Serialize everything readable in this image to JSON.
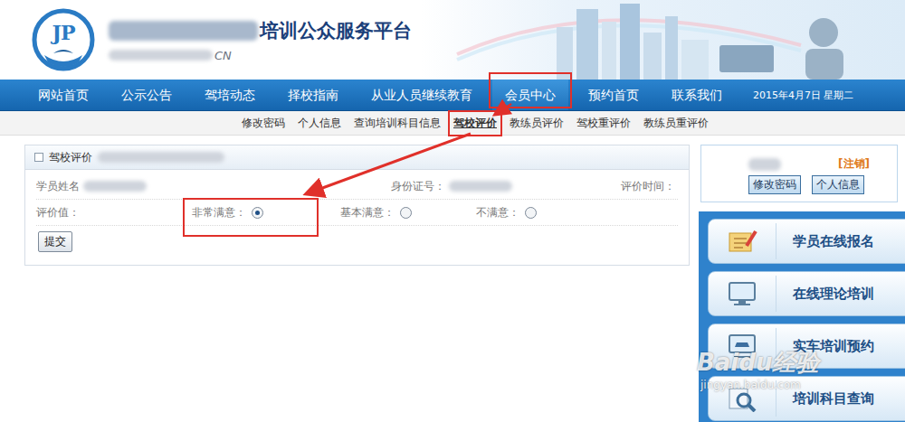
{
  "header": {
    "logo": "JP",
    "title": "培训公众服务平台",
    "subtitle": "CN"
  },
  "nav": [
    {
      "label": "网站首页",
      "selected": false,
      "highlighted": false
    },
    {
      "label": "公示公告",
      "selected": false,
      "highlighted": false
    },
    {
      "label": "驾培动态",
      "selected": false,
      "highlighted": false
    },
    {
      "label": "择校指南",
      "selected": false,
      "highlighted": false
    },
    {
      "label": "从业人员继续教育",
      "selected": false,
      "highlighted": false
    },
    {
      "label": "会员中心",
      "selected": true,
      "highlighted": true
    },
    {
      "label": "预约首页",
      "selected": false,
      "highlighted": false
    },
    {
      "label": "联系我们",
      "selected": false,
      "highlighted": false
    }
  ],
  "date": "2015年4月7日 星期二",
  "subnav": [
    {
      "label": "修改密码",
      "selected": false,
      "highlighted": false
    },
    {
      "label": "个人信息",
      "selected": false,
      "highlighted": false
    },
    {
      "label": "查询培训科目信息",
      "selected": false,
      "highlighted": false
    },
    {
      "label": "驾校评价",
      "selected": true,
      "highlighted": true
    },
    {
      "label": "教练员评价",
      "selected": false,
      "highlighted": false
    },
    {
      "label": "驾校重评价",
      "selected": false,
      "highlighted": false
    },
    {
      "label": "教练员重评价",
      "selected": false,
      "highlighted": false
    }
  ],
  "panel": {
    "title": "驾校评价",
    "fields": [
      {
        "label": "学员姓名",
        "blurred": true
      },
      {
        "label": "身份证号：",
        "blurred": true
      },
      {
        "label": "评价时间：",
        "blurred": false
      }
    ],
    "rating_label": "评价值：",
    "options": [
      {
        "label": "非常满意：",
        "selected": true,
        "highlighted": true
      },
      {
        "label": "基本满意：",
        "selected": false,
        "highlighted": false
      },
      {
        "label": "不满意：",
        "selected": false,
        "highlighted": false
      }
    ],
    "submit": "提交"
  },
  "user": {
    "logout": "[注销]",
    "buttons": [
      "修改密码",
      "个人信息"
    ]
  },
  "sidebar": [
    {
      "label": "学员在线报名",
      "icon": "form"
    },
    {
      "label": "在线理论培训",
      "icon": "monitor"
    },
    {
      "label": "实车培训预约",
      "icon": "car"
    },
    {
      "label": "培训科目查询",
      "icon": "search"
    }
  ],
  "watermark": {
    "brand": "Baidu经验",
    "url": "jingyan.baidu.com"
  }
}
